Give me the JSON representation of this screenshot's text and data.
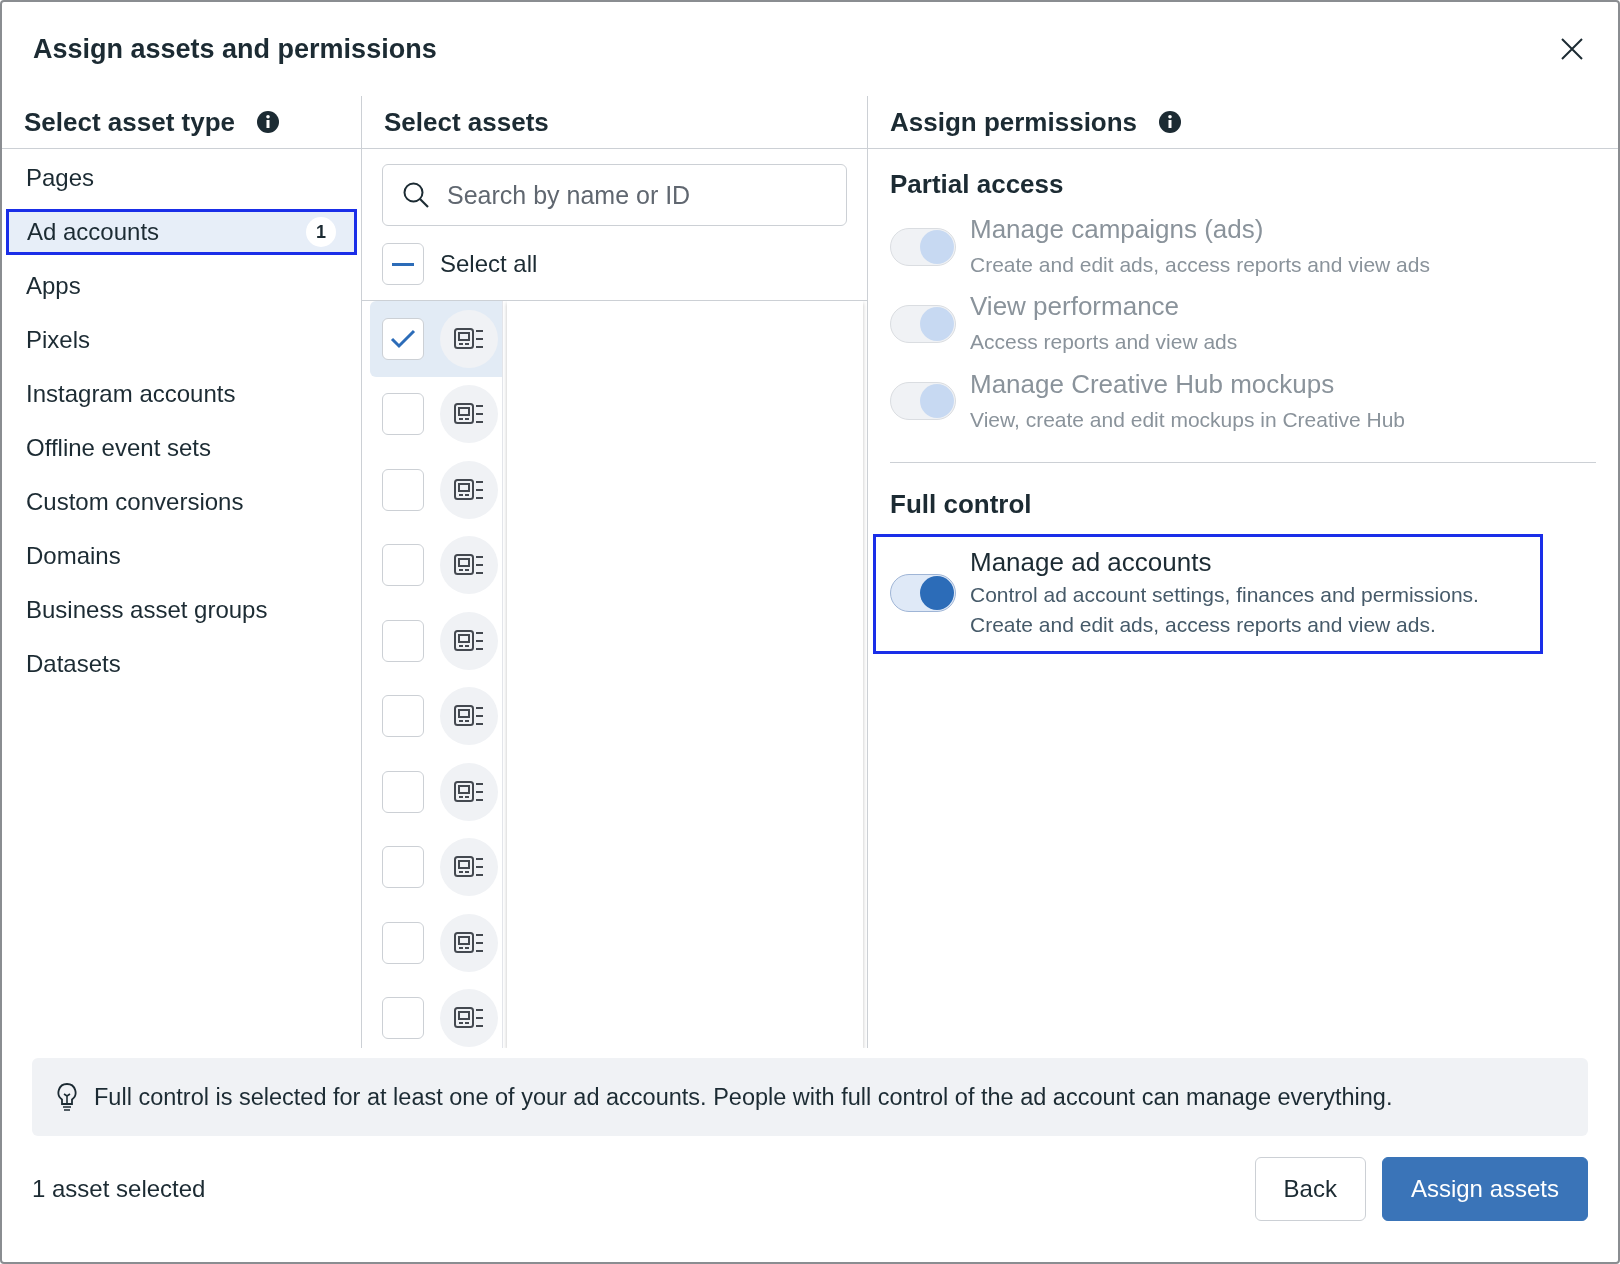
{
  "dialog": {
    "title": "Assign assets and permissions"
  },
  "asset_types": {
    "heading": "Select asset type",
    "items": [
      {
        "label": "Pages",
        "selected": false
      },
      {
        "label": "Ad accounts",
        "selected": true,
        "badge": "1"
      },
      {
        "label": "Apps",
        "selected": false
      },
      {
        "label": "Pixels",
        "selected": false
      },
      {
        "label": "Instagram accounts",
        "selected": false
      },
      {
        "label": "Offline event sets",
        "selected": false
      },
      {
        "label": "Custom conversions",
        "selected": false
      },
      {
        "label": "Domains",
        "selected": false
      },
      {
        "label": "Business asset groups",
        "selected": false
      },
      {
        "label": "Datasets",
        "selected": false
      }
    ]
  },
  "assets": {
    "heading": "Select assets",
    "search": {
      "placeholder": "Search by name or ID"
    },
    "select_all": {
      "label": "Select all",
      "indeterminate": true
    },
    "rows": [
      {
        "checked": true,
        "selected": true
      },
      {
        "checked": false,
        "selected": false
      },
      {
        "checked": false,
        "selected": false
      },
      {
        "checked": false,
        "selected": false
      },
      {
        "checked": false,
        "selected": false
      },
      {
        "checked": false,
        "selected": false
      },
      {
        "checked": false,
        "selected": false
      },
      {
        "checked": false,
        "selected": false
      },
      {
        "checked": false,
        "selected": false
      },
      {
        "checked": false,
        "selected": false
      }
    ]
  },
  "permissions": {
    "heading": "Assign permissions",
    "groups": [
      {
        "title": "Partial access",
        "items": [
          {
            "title": "Manage campaigns (ads)",
            "description": "Create and edit ads, access reports and view ads",
            "on": true,
            "disabled": true
          },
          {
            "title": "View performance",
            "description": "Access reports and view ads",
            "on": true,
            "disabled": true
          },
          {
            "title": "Manage Creative Hub mockups",
            "description": "View, create and edit mockups in Creative Hub",
            "on": true,
            "disabled": true
          }
        ]
      },
      {
        "title": "Full control",
        "items": [
          {
            "title": "Manage ad accounts",
            "description": "Control ad account settings, finances and permissions. Create and edit ads, access reports and view ads.",
            "on": true,
            "disabled": false,
            "highlighted": true
          }
        ]
      }
    ]
  },
  "notice": {
    "text": "Full control is selected for at least one of your ad accounts. People with full control of the ad account can manage everything."
  },
  "footer": {
    "status": "1 asset selected",
    "buttons": [
      {
        "label": "Back",
        "kind": "secondary"
      },
      {
        "label": "Assign assets",
        "kind": "primary"
      }
    ]
  }
}
